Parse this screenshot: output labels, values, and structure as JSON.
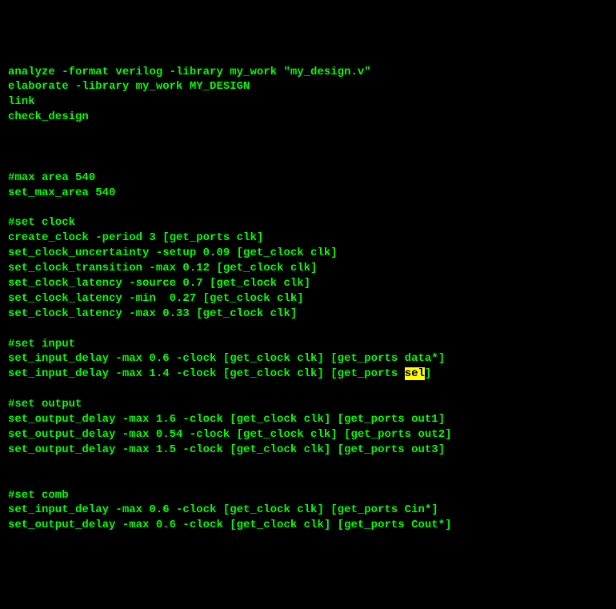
{
  "lines": [
    {
      "text": "analyze -format verilog -library my_work \"my_design.v\""
    },
    {
      "text": "elaborate -library my_work MY_DESIGN"
    },
    {
      "text": "link"
    },
    {
      "text": "check_design"
    },
    {
      "text": ""
    },
    {
      "text": ""
    },
    {
      "text": ""
    },
    {
      "text": "#max area 540"
    },
    {
      "text": "set_max_area 540"
    },
    {
      "text": ""
    },
    {
      "text": "#set clock"
    },
    {
      "text": "create_clock -period 3 [get_ports clk]"
    },
    {
      "text": "set_clock_uncertainty -setup 0.09 [get_clock clk]"
    },
    {
      "text": "set_clock_transition -max 0.12 [get_clock clk]"
    },
    {
      "text": "set_clock_latency -source 0.7 [get_clock clk]"
    },
    {
      "text": "set_clock_latency -min  0.27 [get_clock clk]"
    },
    {
      "text": "set_clock_latency -max 0.33 [get_clock clk]"
    },
    {
      "text": ""
    },
    {
      "text": "#set input"
    },
    {
      "text": "set_input_delay -max 0.6 -clock [get_clock clk] [get_ports data*]"
    },
    {
      "parts": [
        {
          "text": "set_input_delay -max 1.4 -clock [get_clock clk] [get_ports "
        },
        {
          "text": "sel",
          "highlight": true
        },
        {
          "text": "]"
        }
      ]
    },
    {
      "text": ""
    },
    {
      "text": "#set output"
    },
    {
      "text": "set_output_delay -max 1.6 -clock [get_clock clk] [get_ports out1]"
    },
    {
      "text": "set_output_delay -max 0.54 -clock [get_clock clk] [get_ports out2]"
    },
    {
      "text": "set_output_delay -max 1.5 -clock [get_clock clk] [get_ports out3]"
    },
    {
      "text": ""
    },
    {
      "text": ""
    },
    {
      "text": "#set comb"
    },
    {
      "text": "set_input_delay -max 0.6 -clock [get_clock clk] [get_ports Cin*]"
    },
    {
      "text": "set_output_delay -max 0.6 -clock [get_clock clk] [get_ports Cout*]"
    }
  ]
}
